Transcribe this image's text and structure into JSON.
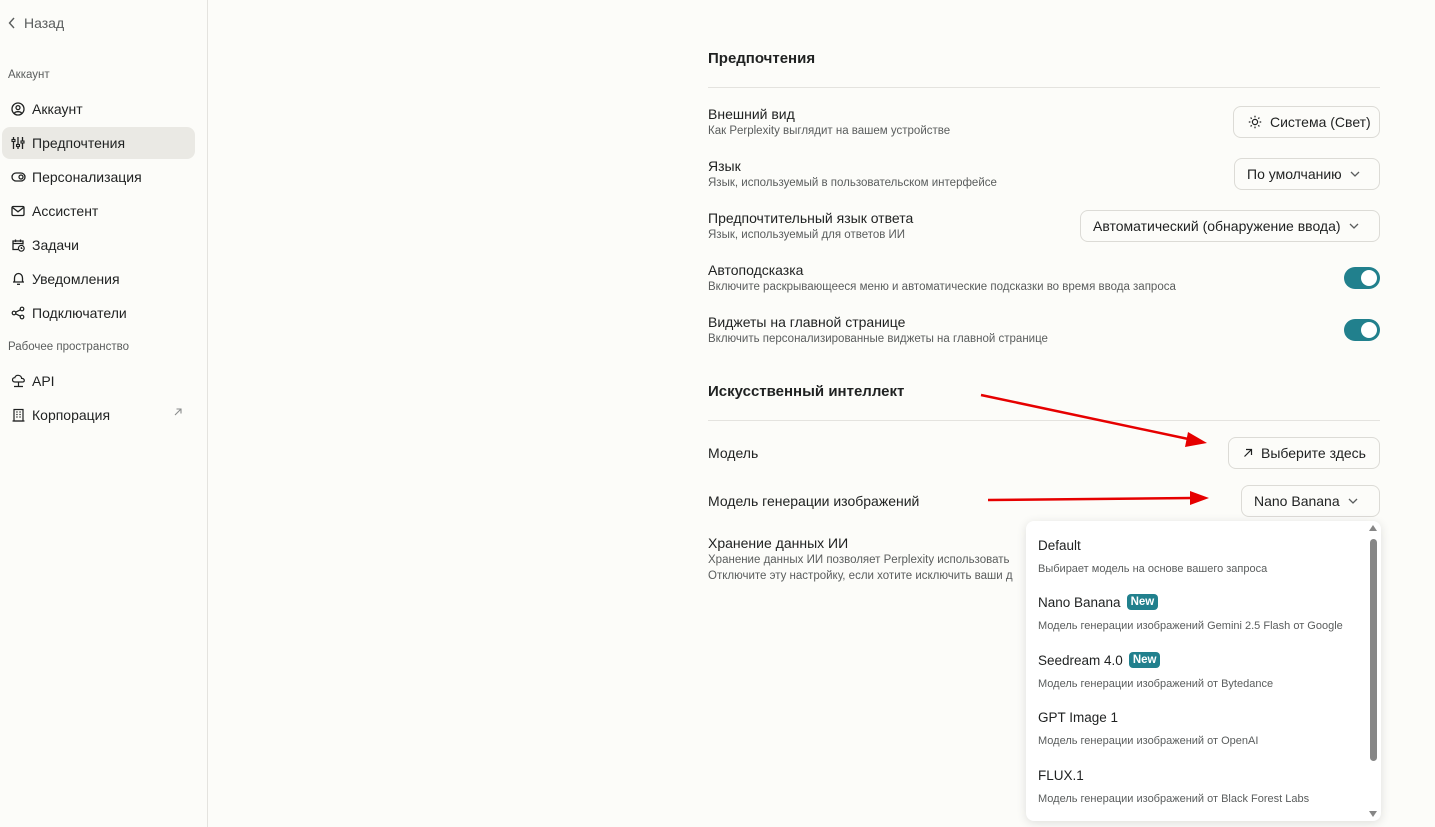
{
  "sidebar": {
    "back_label": "Назад",
    "section_account": "Аккаунт",
    "section_workspace": "Рабочее пространство",
    "items": [
      {
        "label": "Аккаунт",
        "icon": "user-circle-icon",
        "active": false
      },
      {
        "label": "Предпочтения",
        "icon": "sliders-icon",
        "active": true
      },
      {
        "label": "Персонализация",
        "icon": "toggle-icon",
        "active": false
      },
      {
        "label": "Ассистент",
        "icon": "mail-icon",
        "active": false
      },
      {
        "label": "Задачи",
        "icon": "calendar-clock-icon",
        "active": false
      },
      {
        "label": "Уведомления",
        "icon": "bell-icon",
        "active": false
      },
      {
        "label": "Подключатели",
        "icon": "share-nodes-icon",
        "active": false
      }
    ],
    "workspace_items": [
      {
        "label": "API",
        "icon": "cloud-network-icon"
      },
      {
        "label": "Корпорация",
        "icon": "building-icon",
        "external": true
      }
    ]
  },
  "preferences": {
    "heading": "Предпочтения",
    "appearance": {
      "title": "Внешний вид",
      "desc": "Как Perplexity выглядит на вашем устройстве",
      "value": "Система (Свет)"
    },
    "language": {
      "title": "Язык",
      "desc": "Язык, используемый в пользовательском интерфейсе",
      "value": "По умолчанию"
    },
    "answer_language": {
      "title": "Предпочтительный язык ответа",
      "desc": "Язык, используемый для ответов ИИ",
      "value": "Автоматический (обнаружение ввода)"
    },
    "autosuggest": {
      "title": "Автоподсказка",
      "desc": "Включите раскрывающееся меню и автоматические подсказки во время ввода запроса",
      "enabled": true
    },
    "widgets": {
      "title": "Виджеты на главной странице",
      "desc": "Включить персонализированные виджеты на главной странице",
      "enabled": true
    }
  },
  "ai": {
    "heading": "Искусственный интеллект",
    "model": {
      "title": "Модель",
      "button": "Выберите здесь"
    },
    "image_model": {
      "title": "Модель генерации изображений",
      "value": "Nano Banana"
    },
    "data_retention": {
      "title": "Хранение данных ИИ",
      "desc1": "Хранение данных ИИ позволяет Perplexity использовать",
      "desc2": "Отключите эту настройку, если хотите исключить ваши д"
    }
  },
  "dropdown": {
    "options": [
      {
        "title": "Default",
        "badge": "",
        "desc": "Выбирает модель на основе вашего запроса"
      },
      {
        "title": "Nano Banana",
        "badge": "New",
        "desc": "Модель генерации изображений Gemini 2.5 Flash от Google"
      },
      {
        "title": "Seedream 4.0",
        "badge": "New",
        "desc": "Модель генерации изображений от Bytedance"
      },
      {
        "title": "GPT Image 1",
        "badge": "",
        "desc": "Модель генерации изображений от OpenAI"
      },
      {
        "title": "FLUX.1",
        "badge": "",
        "desc": "Модель генерации изображений от Black Forest Labs"
      }
    ]
  },
  "colors": {
    "accent": "#21808d",
    "annotation_arrow": "#e60000"
  }
}
